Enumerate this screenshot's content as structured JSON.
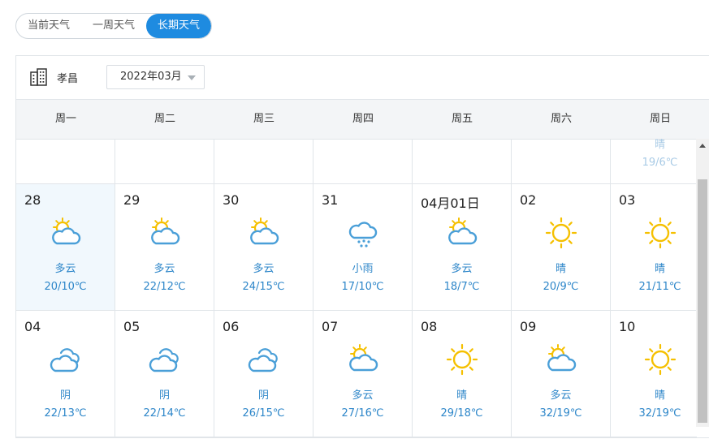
{
  "tabs": [
    {
      "label": "当前天气",
      "active": false
    },
    {
      "label": "一周天气",
      "active": false
    },
    {
      "label": "长期天气",
      "active": true
    }
  ],
  "toolbar": {
    "city_icon": "building-icon",
    "city": "孝昌",
    "month": "2022年03月"
  },
  "weekdays": [
    "周一",
    "周二",
    "周三",
    "周四",
    "周五",
    "周六",
    "周日"
  ],
  "partial_row": [
    {
      "date": "",
      "icon": "",
      "cond": "",
      "temp": ""
    },
    {
      "date": "",
      "icon": "",
      "cond": "",
      "temp": ""
    },
    {
      "date": "",
      "icon": "",
      "cond": "",
      "temp": ""
    },
    {
      "date": "",
      "icon": "",
      "cond": "",
      "temp": ""
    },
    {
      "date": "",
      "icon": "",
      "cond": "",
      "temp": ""
    },
    {
      "date": "",
      "icon": "",
      "cond": "",
      "temp": ""
    },
    {
      "date": "",
      "icon": "",
      "cond": "晴",
      "temp": "19/6℃"
    }
  ],
  "week1": [
    {
      "date": "28",
      "icon": "partly-cloudy-icon",
      "cond": "多云",
      "temp": "20/10℃"
    },
    {
      "date": "29",
      "icon": "partly-cloudy-icon",
      "cond": "多云",
      "temp": "22/12℃"
    },
    {
      "date": "30",
      "icon": "partly-cloudy-icon",
      "cond": "多云",
      "temp": "24/15℃"
    },
    {
      "date": "31",
      "icon": "light-rain-icon",
      "cond": "小雨",
      "temp": "17/10℃"
    },
    {
      "date": "04月01日",
      "icon": "partly-cloudy-icon",
      "cond": "多云",
      "temp": "18/7℃"
    },
    {
      "date": "02",
      "icon": "sunny-icon",
      "cond": "晴",
      "temp": "20/9℃"
    },
    {
      "date": "03",
      "icon": "sunny-icon",
      "cond": "晴",
      "temp": "21/11℃"
    }
  ],
  "week2": [
    {
      "date": "04",
      "icon": "overcast-icon",
      "cond": "阴",
      "temp": "22/13℃"
    },
    {
      "date": "05",
      "icon": "overcast-icon",
      "cond": "阴",
      "temp": "22/14℃"
    },
    {
      "date": "06",
      "icon": "overcast-icon",
      "cond": "阴",
      "temp": "26/15℃"
    },
    {
      "date": "07",
      "icon": "partly-cloudy-icon",
      "cond": "多云",
      "temp": "27/16℃"
    },
    {
      "date": "08",
      "icon": "sunny-icon",
      "cond": "晴",
      "temp": "29/18℃"
    },
    {
      "date": "09",
      "icon": "partly-cloudy-icon",
      "cond": "多云",
      "temp": "32/19℃"
    },
    {
      "date": "10",
      "icon": "sunny-icon",
      "cond": "晴",
      "temp": "32/19℃"
    }
  ],
  "colors": {
    "accent": "#1e8be0",
    "text_blue": "#2d86c9",
    "sun": "#f5c000",
    "cloud": "#4a9fd8",
    "highlight": "#f1f8fd"
  }
}
